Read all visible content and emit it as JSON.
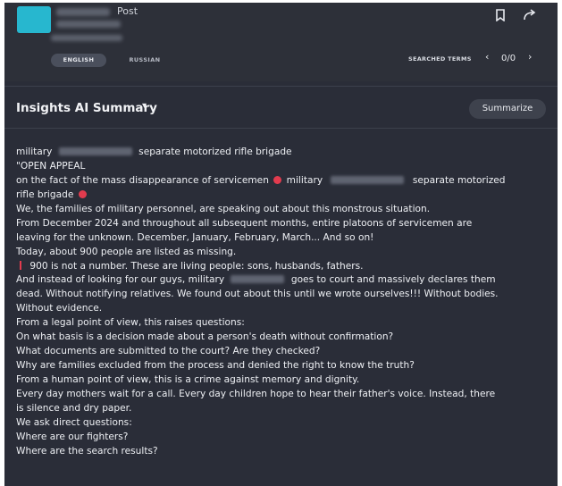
{
  "post": {
    "label": "Post",
    "thumb_color": "#27b7cf",
    "bookmark_icon": "bookmark-icon",
    "share_icon": "share-arrow-icon"
  },
  "languages": [
    {
      "label": "ENGLISH",
      "selected": true
    },
    {
      "label": "RUSSIAN",
      "selected": false
    }
  ],
  "search_nav": {
    "label": "SEARCHED TERMS",
    "prev": "‹",
    "count": "0/0",
    "next": "›"
  },
  "insights": {
    "title": "Insights AI Summary",
    "caret": "▾",
    "summarize_label": "Summarize"
  },
  "summary": {
    "l1a": "military",
    "l1b": "separate motorized rifle brigade",
    "l2": "\"OPEN APPEAL",
    "l3a": "on the fact of the mass disappearance of servicemen",
    "l3b": "military",
    "l3c": "separate motorized",
    "l4": "rifle brigade",
    "l5": "We, the families of military personnel, are speaking out about this monstrous situation.",
    "l6": "From December 2024 and throughout all subsequent months, entire platoons of servicemen are",
    "l7": "leaving for the unknown. December, January, February, March... And so on!",
    "l8": "Today, about 900 people are listed as missing.",
    "l9": "900 is not a number. These are living people: sons, husbands, fathers.",
    "l10a": "And instead of looking for our guys, military",
    "l10b": "goes to court and massively declares them",
    "l11": "dead. Without notifying relatives. We found out about this until we wrote ourselves!!! Without bodies.",
    "l12": "Without evidence.",
    "l13": "From a legal point of view, this raises questions:",
    "l14": "On what basis is a decision made about a person's death without confirmation?",
    "l15": "What documents are submitted to the court? Are they checked?",
    "l16": "Why are families excluded from the process and denied the right to know the truth?",
    "l17": "From a human point of view, this is a crime against memory and dignity.",
    "l18": "Every day mothers wait for a call. Every day children hope to hear their father's voice. Instead, there",
    "l19": "is silence and dry paper.",
    "l20": "We ask direct questions:",
    "l21": "Where are our fighters?",
    "l22": "Where are the search results?"
  }
}
